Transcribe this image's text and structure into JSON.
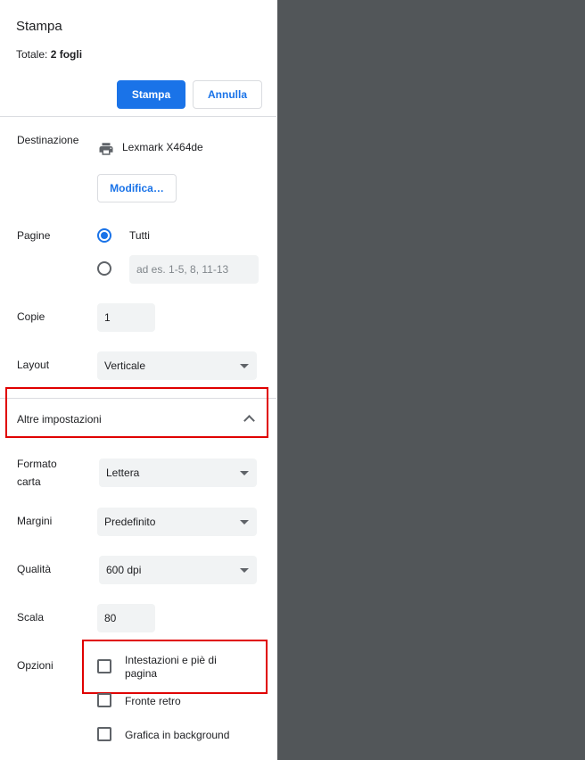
{
  "header": {
    "title": "Stampa",
    "total_prefix": "Totale: ",
    "total_value": "2 fogli",
    "print_label": "Stampa",
    "cancel_label": "Annulla"
  },
  "destination": {
    "label": "Destinazione",
    "printer": "Lexmark X464de",
    "change_label": "Modifica…",
    "icon": "printer-icon"
  },
  "pages": {
    "label": "Pagine",
    "all_label": "Tutti",
    "custom_placeholder": "ad es. 1-5, 8, 11-13"
  },
  "copies": {
    "label": "Copie",
    "value": "1"
  },
  "layout": {
    "label": "Layout",
    "value": "Verticale"
  },
  "more_settings": {
    "label": "Altre impostazioni"
  },
  "paper": {
    "label": "Formato carta",
    "value": "Lettera"
  },
  "margins": {
    "label": "Margini",
    "value": "Predefinito"
  },
  "quality": {
    "label": "Qualità",
    "value": "600 dpi"
  },
  "scale": {
    "label": "Scala",
    "value": "80"
  },
  "options": {
    "label": "Opzioni",
    "items": [
      "Intestazioni e piè di pagina",
      "Fronte retro",
      "Grafica in background"
    ]
  },
  "colors": {
    "accent": "#1a73e8",
    "preview_bg": "#525659",
    "highlight": "#e00000"
  }
}
